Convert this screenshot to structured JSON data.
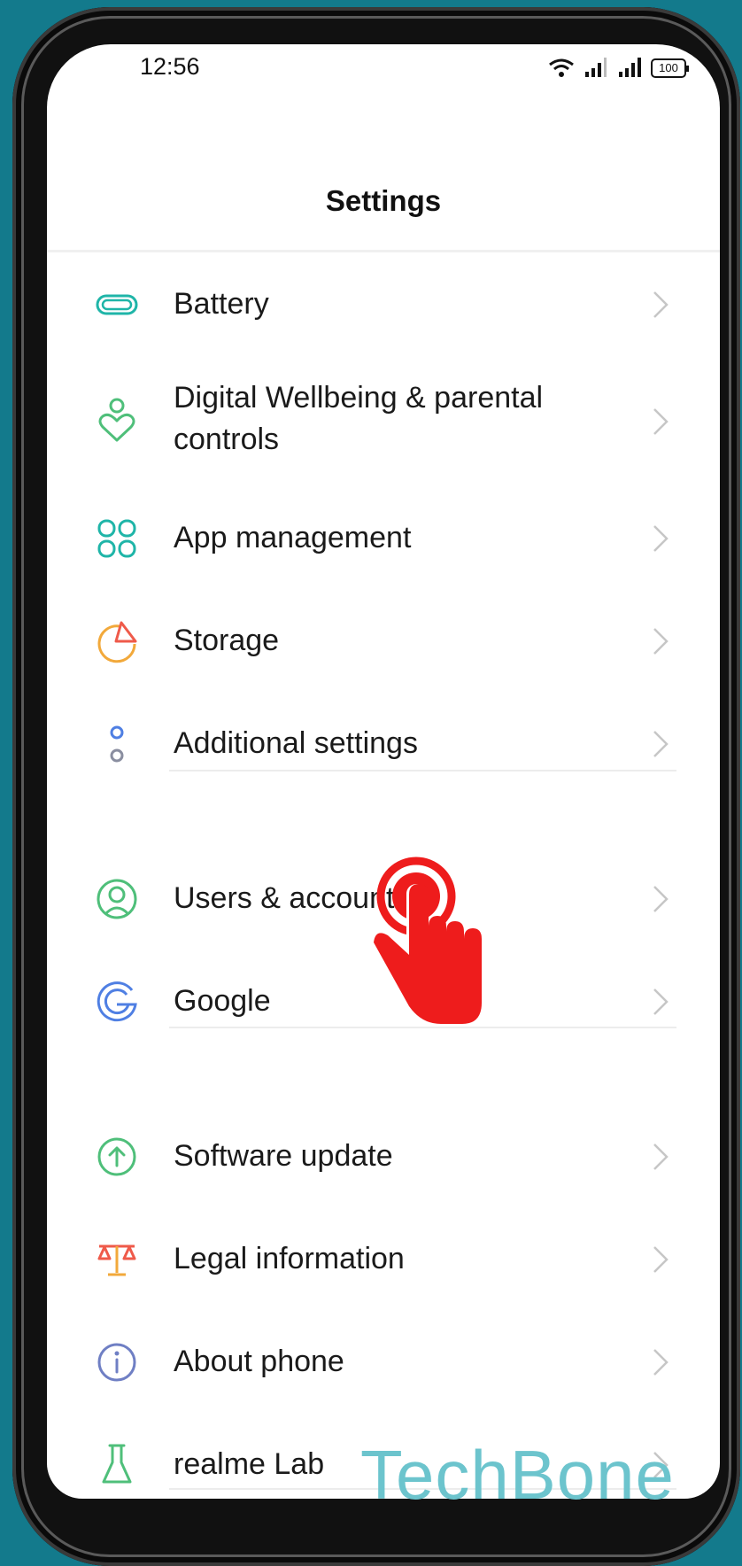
{
  "status_bar": {
    "time": "12:56",
    "battery": "100"
  },
  "header": {
    "title": "Settings"
  },
  "items": [
    {
      "label": "Battery",
      "icon": "battery-icon"
    },
    {
      "label": "Digital Wellbeing & parental controls",
      "icon": "heart-person-icon"
    },
    {
      "label": "App management",
      "icon": "apps-icon"
    },
    {
      "label": "Storage",
      "icon": "pie-chart-icon"
    },
    {
      "label": "Additional settings",
      "icon": "dots-icon"
    },
    {
      "label": "Users & accounts",
      "icon": "user-circle-icon"
    },
    {
      "label": "Google",
      "icon": "google-icon"
    },
    {
      "label": "Software update",
      "icon": "arrow-up-circle-icon"
    },
    {
      "label": "Legal information",
      "icon": "scales-icon"
    },
    {
      "label": "About phone",
      "icon": "info-icon"
    },
    {
      "label": "realme Lab",
      "icon": "flask-icon"
    }
  ],
  "watermark": "TechBone",
  "colors": {
    "teal": "#1fb5a8",
    "green": "#4fbf7a",
    "orange": "#f2a93b",
    "blue": "#4f7fe3",
    "pointer_red": "#ee1c1c"
  }
}
